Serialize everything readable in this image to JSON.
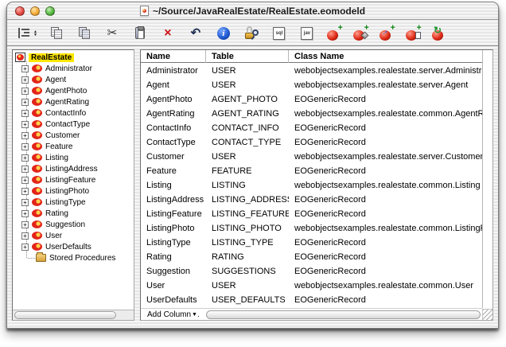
{
  "window": {
    "title": "~/Source/JavaRealEstate/RealEstate.eomodeld"
  },
  "icons": {
    "plus": "+",
    "cut": "✂",
    "undo": "↶",
    "delete": "×",
    "info": "i",
    "stepper_up": "▲",
    "stepper_down": "▼",
    "badge_plus": "+",
    "arrow": "→",
    "cycle": "↻",
    "triangle_down": "▼"
  },
  "toolbar": {
    "sql_doc_label": "sql",
    "java_doc_label": "jav"
  },
  "sidebar": {
    "root": "RealEstate",
    "entities": [
      "Administrator",
      "Agent",
      "AgentPhoto",
      "AgentRating",
      "ContactInfo",
      "ContactType",
      "Customer",
      "Feature",
      "Listing",
      "ListingAddress",
      "ListingFeature",
      "ListingPhoto",
      "ListingType",
      "Rating",
      "Suggestion",
      "User",
      "UserDefaults"
    ],
    "stored_procedures": "Stored Procedures"
  },
  "table": {
    "columns": [
      "Name",
      "Table",
      "Class Name"
    ],
    "rows": [
      [
        "Administrator",
        "USER",
        "webobjectsexamples.realestate.server.Administrator"
      ],
      [
        "Agent",
        "USER",
        "webobjectsexamples.realestate.server.Agent"
      ],
      [
        "AgentPhoto",
        "AGENT_PHOTO",
        "EOGenericRecord"
      ],
      [
        "AgentRating",
        "AGENT_RATING",
        "webobjectsexamples.realestate.common.AgentRating"
      ],
      [
        "ContactInfo",
        "CONTACT_INFO",
        "EOGenericRecord"
      ],
      [
        "ContactType",
        "CONTACT_TYPE",
        "EOGenericRecord"
      ],
      [
        "Customer",
        "USER",
        "webobjectsexamples.realestate.server.Customer"
      ],
      [
        "Feature",
        "FEATURE",
        "EOGenericRecord"
      ],
      [
        "Listing",
        "LISTING",
        "webobjectsexamples.realestate.common.Listing"
      ],
      [
        "ListingAddress",
        "LISTING_ADDRESS",
        "EOGenericRecord"
      ],
      [
        "ListingFeature",
        "LISTING_FEATURE",
        "EOGenericRecord"
      ],
      [
        "ListingPhoto",
        "LISTING_PHOTO",
        "webobjectsexamples.realestate.common.ListingPhoto"
      ],
      [
        "ListingType",
        "LISTING_TYPE",
        "EOGenericRecord"
      ],
      [
        "Rating",
        "RATING",
        "EOGenericRecord"
      ],
      [
        "Suggestion",
        "SUGGESTIONS",
        "EOGenericRecord"
      ],
      [
        "User",
        "USER",
        "webobjectsexamples.realestate.common.User"
      ],
      [
        "UserDefaults",
        "USER_DEFAULTS",
        "EOGenericRecord"
      ]
    ],
    "add_column_label": "Add Column",
    "add_column_suffix": "."
  },
  "colors": {
    "selection": "#ffe600",
    "entity_red": "#e3241a",
    "badge_green": "#0e7d14"
  }
}
